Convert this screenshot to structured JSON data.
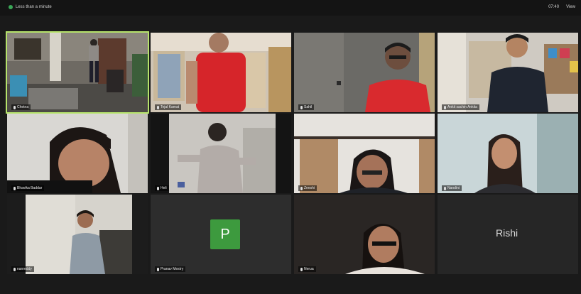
{
  "topbar": {
    "status": "Less than a minute",
    "time": "07:40",
    "view": "View"
  },
  "participants": [
    {
      "name": "Chetna",
      "active": true
    },
    {
      "name": "Tejal Kamat"
    },
    {
      "name": "Sahil"
    },
    {
      "name": "Ankit sachin Ankita"
    },
    {
      "name": "Bhavika Baddar"
    },
    {
      "name": "Heli"
    },
    {
      "name": "Zeeshi"
    },
    {
      "name": "Nandini"
    },
    {
      "name": "nanreddy"
    },
    {
      "name": "Pranav Mestry",
      "avatar_letter": "P"
    },
    {
      "name": "Nerua"
    },
    {
      "name": "",
      "display_name": "Rishi"
    }
  ],
  "colors": {
    "active_outline": "#b6e36b",
    "avatar_green": "#3d9a3e"
  }
}
